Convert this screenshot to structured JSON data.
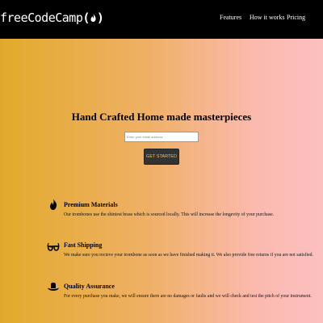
{
  "brand": {
    "logo_text": "freeCodeCamp",
    "logo_mark": "(🔥)"
  },
  "nav": {
    "links": [
      "Features",
      "How it works",
      "Pricing"
    ]
  },
  "hero": {
    "title": "Hand Crafted Home made masterpieces",
    "email_placeholder": "Enter your email address",
    "cta_label": "GET STARTED"
  },
  "features": [
    {
      "icon": "fire-icon",
      "title": "Premium Materials",
      "description": "Our trombones use the shiniest brass which is sourced locally. This will increase the longevity of your purchase."
    },
    {
      "icon": "glasses-icon",
      "title": "Fast Shipping",
      "description": "We make sure you recieve your trombone as soon as we have finished making it. We also provide free returns if you are not satisfied."
    },
    {
      "icon": "cowboy-hat-icon",
      "title": "Quality Assurance",
      "description": "For every purchase you make, we will ensure there are no damages or faults and we will check and test the pitch of your instrument."
    }
  ]
}
